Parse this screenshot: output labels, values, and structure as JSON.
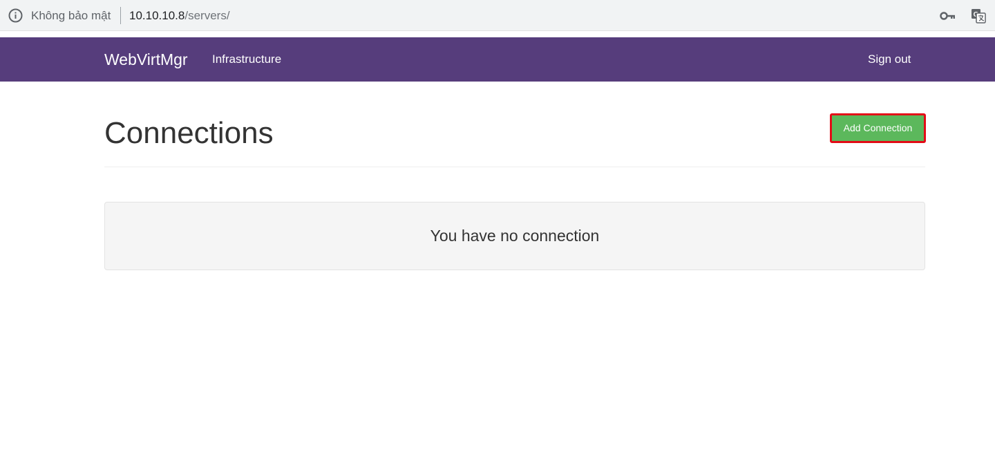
{
  "browser": {
    "security_label": "Không bảo mật",
    "url_host": "10.10.10.8",
    "url_path": "/servers/",
    "icons": [
      "info-icon",
      "key-icon",
      "translate-icon"
    ]
  },
  "navbar": {
    "brand": "WebVirtMgr",
    "infrastructure": "Infrastructure",
    "sign_out": "Sign out",
    "background_color": "#563d7c"
  },
  "main": {
    "title": "Connections",
    "add_button": "Add Connection",
    "add_button_color": "#5cb85c",
    "highlight_color": "#e30b17",
    "empty_message": "You have no connection"
  }
}
